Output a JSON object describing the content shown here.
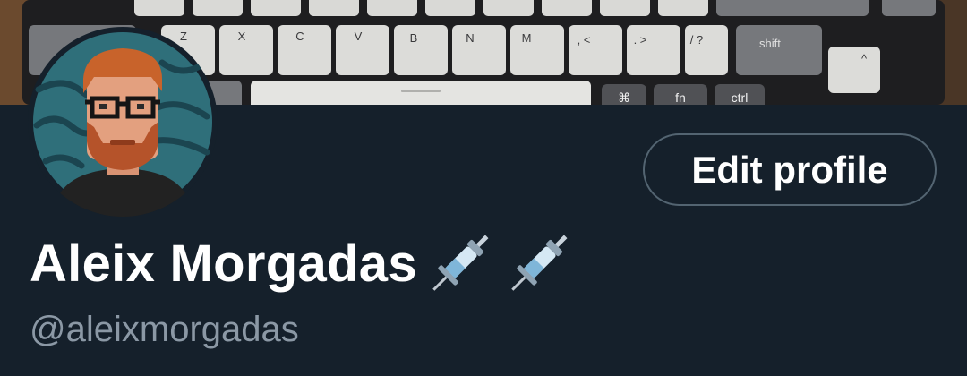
{
  "profile": {
    "display_name": "Aleix Morgadas",
    "handle": "@aleixmorgadas",
    "edit_button_label": "Edit profile",
    "name_emojis": [
      "syringe-icon",
      "syringe-icon"
    ]
  },
  "banner": {
    "keycaps": [
      "Z",
      "X",
      "C",
      "V",
      "B",
      "N",
      "M",
      ", <",
      ". >",
      "/ ?",
      "shift",
      "^",
      "⌘",
      "fn",
      "ctrl"
    ]
  },
  "colors": {
    "background": "#15202b",
    "text_primary": "#ffffff",
    "text_secondary": "#8b98a5",
    "button_border": "#536471"
  }
}
